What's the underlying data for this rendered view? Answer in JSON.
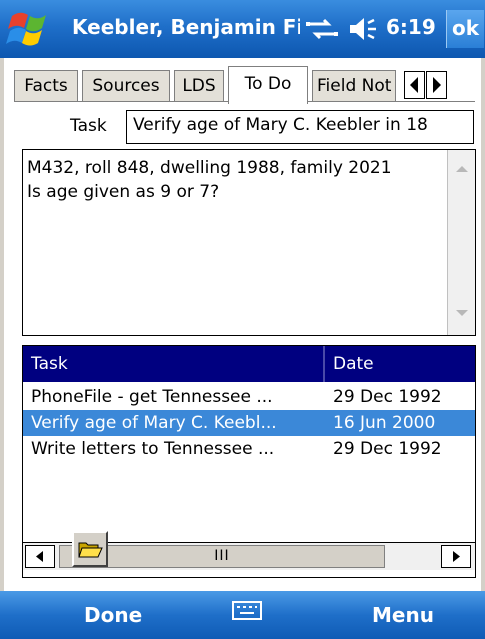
{
  "titlebar": {
    "title": "Keebler, Benjamin Fi",
    "clock": "6:19",
    "ok_label": "ok",
    "icons": [
      "start-flag-icon",
      "connectivity-icon",
      "volume-icon"
    ]
  },
  "tabs": [
    {
      "label": "Facts"
    },
    {
      "label": "Sources"
    },
    {
      "label": "LDS"
    },
    {
      "label": "To Do",
      "active": true
    },
    {
      "label": "Field Not"
    }
  ],
  "task": {
    "label": "Task",
    "value": "Verify age of Mary C. Keebler in 18"
  },
  "notes": {
    "text": "M432, roll 848, dwelling 1988, family 2021\nIs age given as 9 or 7?"
  },
  "list": {
    "columns": [
      "Task",
      "Date"
    ],
    "rows": [
      {
        "task": "PhoneFile - get Tennessee ...",
        "date": "29 Dec 1992",
        "selected": false
      },
      {
        "task": "Verify age of Mary C. Keebl...",
        "date": "16 Jun 2000",
        "selected": true
      },
      {
        "task": "Write letters to Tennessee ...",
        "date": "29 Dec 1992",
        "selected": false
      }
    ],
    "scroll_thumb": "III"
  },
  "menubar": {
    "left": "Done",
    "right": "Menu"
  },
  "colors": {
    "titlebar": "#1f6fc9",
    "header": "#000080",
    "selection": "#3b88d8"
  }
}
